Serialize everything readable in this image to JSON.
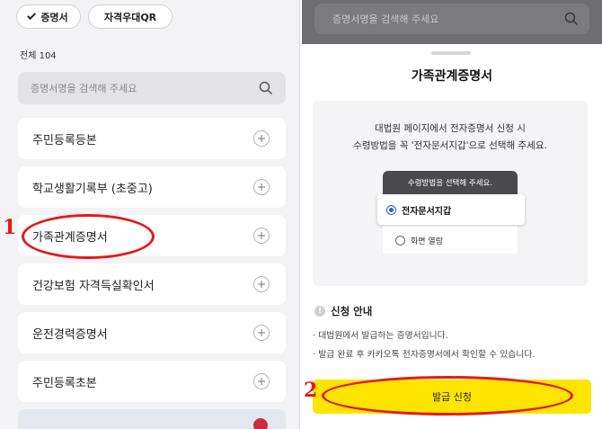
{
  "left": {
    "chips": [
      {
        "label": "증명서",
        "selected": true
      },
      {
        "label": "자격우대QR",
        "selected": false
      }
    ],
    "total": "전체 104",
    "search": {
      "placeholder": "증명서명을 검색해 주세요"
    },
    "items": [
      "주민등록등본",
      "학교생활기록부 (초중고)",
      "가족관계증명서",
      "건강보험 자격득실확인서",
      "운전경력증명서",
      "주민등록초본"
    ],
    "marker": "1"
  },
  "right": {
    "search": {
      "placeholder": "증명서명을 검색해 주세요"
    },
    "sheet": {
      "title": "가족관계증명서",
      "guide_line1": "대법원 페이지에서 전자증명서 신청 시",
      "guide_line2": "수령방법을 꼭 '전자문서지갑'으로 선택해 주세요.",
      "popup_title": "수령방법을 선택해 주세요.",
      "options": [
        {
          "label": "전자문서지갑",
          "selected": true
        },
        {
          "label": "화면 열람",
          "selected": false
        }
      ],
      "notice_title": "신청 안내",
      "notices": [
        "· 대법원에서 발급하는 증명서입니다.",
        "· 발급 완료 후 카카오톡 전자증명서에서 확인할 수 있습니다."
      ],
      "issue_button": "발급 신청"
    },
    "marker": "2"
  },
  "colors": {
    "accent_yellow": "#fee500",
    "annotation_red": "#e21b1b",
    "radio_blue": "#2f5bd4"
  }
}
